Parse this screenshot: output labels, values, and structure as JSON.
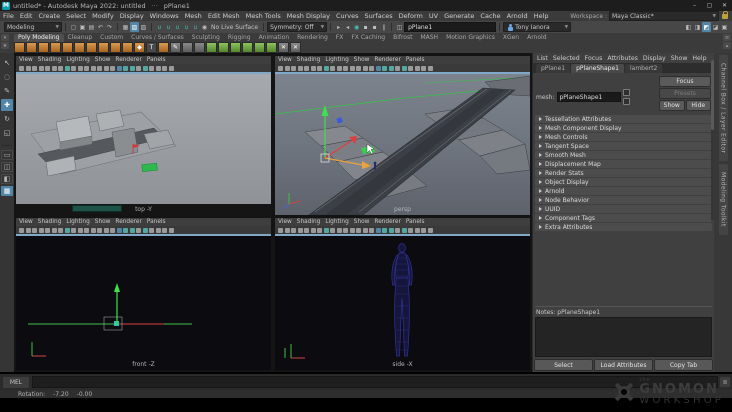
{
  "window": {
    "title": "untitled* - Autodesk Maya 2022: untitled",
    "dots": "···",
    "doc": "pPlane1",
    "minimize": "–",
    "maximize": "▢",
    "close": "✕"
  },
  "menus": [
    "File",
    "Edit",
    "Create",
    "Select",
    "Modify",
    "Display",
    "Windows",
    "Mesh",
    "Edit Mesh",
    "Mesh Tools",
    "Mesh Display",
    "Curves",
    "Surfaces",
    "Deform",
    "UV",
    "Generate",
    "Cache",
    "Arnold",
    "Help"
  ],
  "workspace": {
    "label": "Workspace :",
    "value": "Maya Classic*"
  },
  "status_line": {
    "menuset": "Modeling",
    "file_icons": [
      {
        "n": "new-scene-icon",
        "g": "▢"
      },
      {
        "n": "open-scene-icon",
        "g": "▣"
      },
      {
        "n": "save-scene-icon",
        "g": "▤"
      },
      {
        "n": "undo-icon",
        "g": "↶"
      },
      {
        "n": "redo-icon",
        "g": "↷"
      }
    ],
    "mask_icons": [
      {
        "n": "select-hierarchy-icon",
        "g": "▦",
        "cls": ""
      },
      {
        "n": "select-object-icon",
        "g": "▧",
        "cls": "active"
      },
      {
        "n": "select-component-icon",
        "g": "▨",
        "cls": ""
      }
    ],
    "snap_icons": [
      {
        "n": "snap-to-grid-icon",
        "g": "∪",
        "cls": "teal"
      },
      {
        "n": "snap-to-curve-icon",
        "g": "∪",
        "cls": "teal"
      },
      {
        "n": "snap-to-point-icon",
        "g": "∪",
        "cls": "teal"
      },
      {
        "n": "snap-to-projected-center-icon",
        "g": "∪",
        "cls": "teal"
      },
      {
        "n": "snap-to-view-plane-icon",
        "g": "∪",
        "cls": "teal"
      },
      {
        "n": "make-live-icon",
        "g": "◉",
        "cls": ""
      }
    ],
    "no_live_surface": "No Live Surface",
    "symmetry": "Symmetry: Off",
    "history_icons": [
      {
        "n": "input-connections-icon",
        "g": "▸",
        "cls": ""
      },
      {
        "n": "output-connections-icon",
        "g": "◂",
        "cls": ""
      },
      {
        "n": "render-view-icon",
        "g": "◉",
        "cls": "teal"
      },
      {
        "n": "render-current-frame-icon",
        "g": "▪",
        "cls": ""
      },
      {
        "n": "ipr-render-icon",
        "g": "▪",
        "cls": ""
      },
      {
        "n": "pause-icon",
        "g": "∥",
        "cls": ""
      }
    ],
    "pane_icon": {
      "n": "pane-layout-icon",
      "g": "◫"
    },
    "object_name": "pPlane1",
    "character_set": "Tony Ianora",
    "right_icons": [
      {
        "n": "outliner-toggle-icon",
        "g": "◧",
        "cls": ""
      },
      {
        "n": "channel-box-toggle-icon",
        "g": "◨",
        "cls": ""
      },
      {
        "n": "attribute-editor-toggle-icon",
        "g": "◩",
        "cls": "active"
      },
      {
        "n": "tool-settings-toggle-icon",
        "g": "◪",
        "cls": ""
      },
      {
        "n": "modeling-toolkit-toggle-icon",
        "g": "▣",
        "cls": ""
      }
    ]
  },
  "shelf": {
    "tabs": [
      {
        "label": "Poly Modeling",
        "cls": "active"
      },
      {
        "label": "Cleanup",
        "cls": ""
      },
      {
        "label": "Custom",
        "cls": ""
      },
      {
        "label": "Curves / Surfaces",
        "cls": ""
      },
      {
        "label": "Sculpting",
        "cls": ""
      },
      {
        "label": "Rigging",
        "cls": ""
      },
      {
        "label": "Animation",
        "cls": ""
      },
      {
        "label": "Rendering",
        "cls": ""
      },
      {
        "label": "FX",
        "cls": ""
      },
      {
        "label": "FX Caching",
        "cls": ""
      },
      {
        "label": "Bifrost",
        "cls": ""
      },
      {
        "label": "MASH",
        "cls": ""
      },
      {
        "label": "Motion Graphics",
        "cls": ""
      },
      {
        "label": "XGen",
        "cls": ""
      },
      {
        "label": "Arnold",
        "cls": ""
      }
    ],
    "icons": [
      {
        "n": "polygon-sphere-icon",
        "cls": "orange",
        "g": ""
      },
      {
        "n": "polygon-cube-icon",
        "cls": "orange",
        "g": ""
      },
      {
        "n": "polygon-cylinder-icon",
        "cls": "orange",
        "g": ""
      },
      {
        "n": "polygon-cone-icon",
        "cls": "orange",
        "g": ""
      },
      {
        "n": "polygon-torus-icon",
        "cls": "orange",
        "g": ""
      },
      {
        "n": "polygon-plane-icon",
        "cls": "orange",
        "g": ""
      },
      {
        "n": "polygon-disc-icon",
        "cls": "orange",
        "g": ""
      },
      {
        "n": "platonic-solid-icon",
        "cls": "orange",
        "g": ""
      },
      {
        "n": "polygon-helix-icon",
        "cls": "orange",
        "g": ""
      },
      {
        "n": "super-ellipse-icon",
        "cls": "orange",
        "g": ""
      },
      {
        "n": "sweep-mesh-icon",
        "cls": "orange",
        "g": "◆"
      },
      {
        "n": "polygon-type-icon",
        "cls": "dark",
        "g": "T"
      },
      {
        "n": "svg-icon",
        "cls": "orange",
        "g": ""
      },
      {
        "n": "multi-cut-icon",
        "cls": "tool",
        "g": "✎"
      },
      {
        "n": "quad-draw-icon",
        "cls": "tool",
        "g": ""
      },
      {
        "n": "target-weld-icon",
        "cls": "tool",
        "g": ""
      },
      {
        "n": "boolean-union-icon",
        "cls": "green",
        "g": ""
      },
      {
        "n": "boolean-difference-icon",
        "cls": "green",
        "g": ""
      },
      {
        "n": "boolean-intersection-icon",
        "cls": "green",
        "g": ""
      },
      {
        "n": "boolean-slice-icon",
        "cls": "green",
        "g": ""
      },
      {
        "n": "combine-icon",
        "cls": "green",
        "g": ""
      },
      {
        "n": "separate-icon",
        "cls": "green",
        "g": ""
      },
      {
        "n": "mirror-icon",
        "cls": "tool",
        "g": "✕"
      },
      {
        "n": "smooth-icon",
        "cls": "tool",
        "g": "✕"
      }
    ]
  },
  "toolbox": {
    "tools": [
      {
        "n": "select-tool-icon",
        "g": "↖",
        "cls": ""
      },
      {
        "n": "lasso-select-tool-icon",
        "g": "◌",
        "cls": ""
      },
      {
        "n": "paint-select-tool-icon",
        "g": "✎",
        "cls": ""
      },
      {
        "n": "move-tool-icon",
        "g": "✚",
        "cls": "active"
      },
      {
        "n": "rotate-tool-icon",
        "g": "↻",
        "cls": ""
      },
      {
        "n": "scale-tool-icon",
        "g": "◱",
        "cls": ""
      }
    ],
    "layouts": [
      {
        "n": "layout-single-pane-icon",
        "g": "▭",
        "cls": ""
      },
      {
        "n": "layout-two-pane-icon",
        "g": "◫",
        "cls": ""
      },
      {
        "n": "layout-persp-outliner-icon",
        "g": "◧",
        "cls": ""
      },
      {
        "n": "layout-four-pane-icon",
        "g": "▦",
        "cls": "active"
      }
    ]
  },
  "viewports": {
    "menu": [
      "View",
      "Shading",
      "Lighting",
      "Show",
      "Renderer",
      "Panels"
    ],
    "top_label": "top -Y",
    "persp_label": "persp",
    "front_label": "front -Z",
    "side_label": "side -X"
  },
  "viewport_icons": [
    {
      "n": "select-camera-icon",
      "cls": ""
    },
    {
      "n": "lock-camera-icon",
      "cls": ""
    },
    {
      "n": "camera-attributes-icon",
      "cls": ""
    },
    {
      "n": "bookmarks-icon",
      "cls": ""
    },
    {
      "n": "image-plane-icon",
      "cls": ""
    },
    {
      "n": "2d-pan-zoom-icon",
      "cls": ""
    },
    {
      "n": "grease-pencil-icon",
      "cls": ""
    },
    {
      "n": "grid-icon",
      "cls": "teal"
    },
    {
      "n": "film-gate-icon",
      "cls": ""
    },
    {
      "n": "resolution-gate-icon",
      "cls": ""
    },
    {
      "n": "gate-mask-icon",
      "cls": ""
    },
    {
      "n": "field-chart-icon",
      "cls": ""
    },
    {
      "n": "safe-action-icon",
      "cls": ""
    },
    {
      "n": "safe-title-icon",
      "cls": ""
    },
    {
      "n": "wireframe-icon",
      "cls": ""
    },
    {
      "n": "shaded-icon",
      "cls": "blue"
    },
    {
      "n": "textured-icon",
      "cls": "teal"
    },
    {
      "n": "use-all-lights-icon",
      "cls": "teal"
    },
    {
      "n": "shadows-icon",
      "cls": ""
    },
    {
      "n": "screen-space-ao-icon",
      "cls": "teal"
    },
    {
      "n": "motion-blur-icon",
      "cls": ""
    },
    {
      "n": "multisampling-icon",
      "cls": ""
    },
    {
      "n": "isolate-select-icon",
      "cls": ""
    },
    {
      "n": "xray-icon",
      "cls": ""
    }
  ],
  "attribute_editor": {
    "menu": [
      "List",
      "Selected",
      "Focus",
      "Attributes",
      "Display",
      "Show",
      "Help"
    ],
    "tabs": [
      {
        "label": "pPlane1",
        "cls": ""
      },
      {
        "label": "pPlaneShape1",
        "cls": "active"
      },
      {
        "label": "lambert2",
        "cls": ""
      }
    ],
    "mesh_label": "mesh:",
    "mesh_value": "pPlaneShape1",
    "focus_btn": "Focus",
    "presets_btn": "Presets",
    "show_btn": "Show",
    "hide_btn": "Hide",
    "sections": [
      "Tessellation Attributes",
      "Mesh Component Display",
      "Mesh Controls",
      "Tangent Space",
      "Smooth Mesh",
      "Displacement Map",
      "Render Stats",
      "Object Display",
      "Arnold",
      "Node Behavior",
      "UUID",
      "Component Tags",
      "Extra Attributes"
    ],
    "notes_label": "Notes: pPlaneShape1",
    "select_btn": "Select",
    "load_btn": "Load Attributes",
    "copy_btn": "Copy Tab"
  },
  "side_tabs": [
    "Channel Box / Layer Editor",
    "Modeling Toolkit"
  ],
  "command_line": {
    "label": "MEL"
  },
  "help_line": {
    "label": "Rotation:",
    "x": "-7.20",
    "y": "-0.00"
  },
  "watermark": {
    "the": "the",
    "line1": "GNOMON",
    "line2": "WORKSHOP"
  },
  "colors": {
    "accent_blue": "#5285a6",
    "snap_teal": "#45c0b5",
    "shelf_orange": "#c98440",
    "selection_green": "#3fd44f",
    "axis_red": "#e03d3d",
    "axis_green": "#3fe04f",
    "axis_blue": "#3a58e0",
    "manip_highlight": "#e8a33d",
    "maya_teal_logo": "#0a9bab"
  }
}
